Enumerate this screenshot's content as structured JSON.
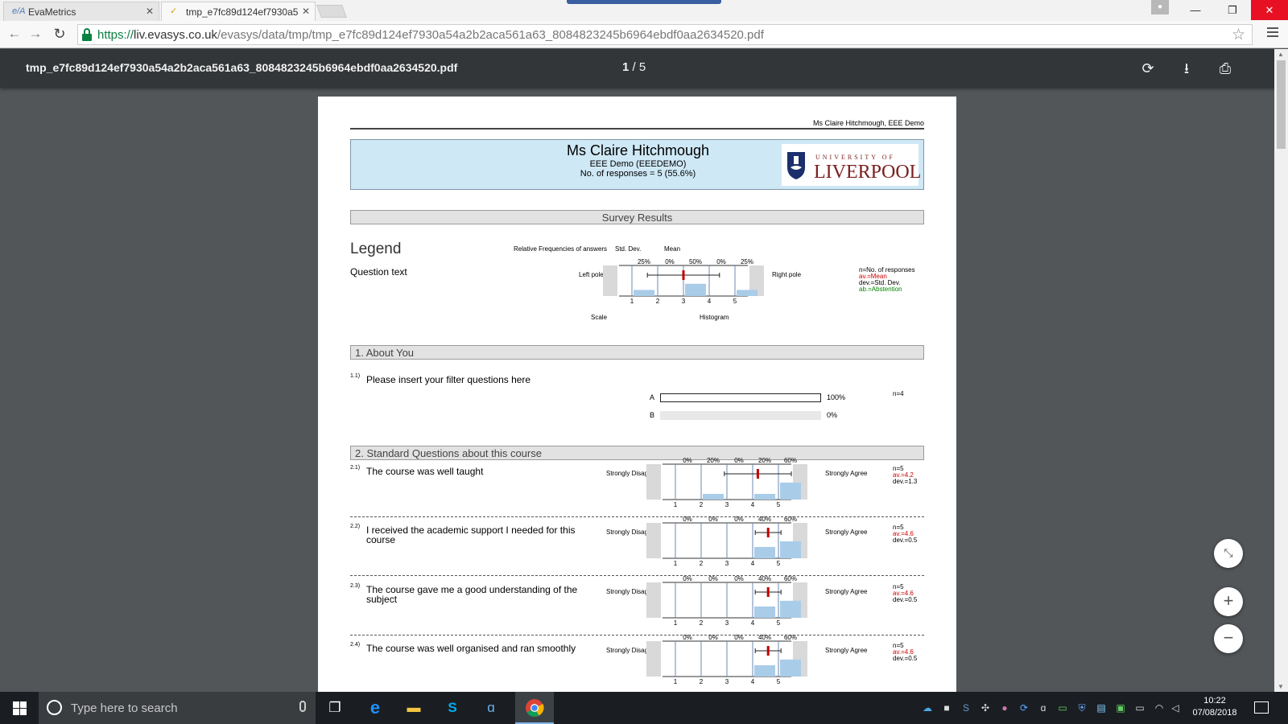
{
  "browser": {
    "tabs": [
      {
        "label": "EvaMetrics",
        "icon": "evametrics-icon"
      },
      {
        "label": "tmp_e7fc89d124ef7930a5",
        "icon": "checkmark-icon"
      }
    ],
    "url": {
      "scheme": "https://",
      "host": "liv.evasys.co.uk",
      "path": "/evasys/data/tmp/tmp_e7fc89d124ef7930a54a2b2aca561a63_8084823245b6964ebdf0aa2634520.pdf"
    }
  },
  "pdf_viewer": {
    "filename": "tmp_e7fc89d124ef7930a54a2b2aca561a63_8084823245b6964ebdf0aa2634520.pdf",
    "page_current": "1",
    "page_total": "/ 5"
  },
  "report": {
    "header_right": "Ms Claire Hitchmough, EEE Demo",
    "title": "Ms Claire Hitchmough",
    "subtitle": "EEE Demo (EEEDEMO)",
    "responses": "No. of responses = 5 (55.6%)",
    "logo": {
      "line1": "UNIVERSITY OF",
      "line2": "LIVERPOOL"
    },
    "survey_results": "Survey Results",
    "legend": {
      "title": "Legend",
      "question_text": "Question text",
      "rel_freq": "Relative Frequencies of answers",
      "std_dev": "Std. Dev.",
      "mean": "Mean",
      "left_pole": "Left pole",
      "right_pole": "Right pole",
      "scale": "Scale",
      "histogram": "Histogram",
      "pcts": [
        "25%",
        "0%",
        "50%",
        "0%",
        "25%"
      ],
      "key_n": "n=No. of responses",
      "key_av": "av.=Mean",
      "key_dev": "dev.=Std. Dev.",
      "key_ab": "ab.=Abstention"
    },
    "section1": {
      "title": "1. About You",
      "q_num": "1.1)",
      "q_text": "Please insert your filter questions here",
      "options": [
        {
          "label": "A",
          "pct": "100%",
          "value": 1.0
        },
        {
          "label": "B",
          "pct": "0%",
          "value": 0.0
        }
      ],
      "n": "n=4"
    },
    "section2": {
      "title": "2. Standard Questions about this course",
      "left_pole": "Strongly Disagree",
      "right_pole": "Strongly Agree",
      "scale": [
        "1",
        "2",
        "3",
        "4",
        "5"
      ],
      "questions": [
        {
          "num": "2.1)",
          "text": "The course was well taught",
          "pcts": [
            "0%",
            "20%",
            "0%",
            "20%",
            "60%"
          ],
          "freq": [
            0,
            20,
            0,
            20,
            60
          ],
          "mean": 4.2,
          "dev": 1.3,
          "n": "n=5",
          "av": "av.=4.2",
          "dv": "dev.=1.3"
        },
        {
          "num": "2.2)",
          "text": "I received the academic support I needed for this course",
          "pcts": [
            "0%",
            "0%",
            "0%",
            "40%",
            "60%"
          ],
          "freq": [
            0,
            0,
            0,
            40,
            60
          ],
          "mean": 4.6,
          "dev": 0.5,
          "n": "n=5",
          "av": "av.=4.6",
          "dv": "dev.=0.5"
        },
        {
          "num": "2.3)",
          "text": "The course gave me a good understanding of the subject",
          "pcts": [
            "0%",
            "0%",
            "0%",
            "40%",
            "60%"
          ],
          "freq": [
            0,
            0,
            0,
            40,
            60
          ],
          "mean": 4.6,
          "dev": 0.5,
          "n": "n=5",
          "av": "av.=4.6",
          "dv": "dev.=0.5"
        },
        {
          "num": "2.4)",
          "text": "The course was well organised and ran smoothly",
          "pcts": [
            "0%",
            "0%",
            "0%",
            "40%",
            "60%"
          ],
          "freq": [
            0,
            0,
            0,
            40,
            60
          ],
          "mean": 4.6,
          "dev": 0.5,
          "n": "n=5",
          "av": "av.=4.6",
          "dv": "dev.=0.5"
        }
      ]
    }
  },
  "taskbar": {
    "search_placeholder": "Type here to search",
    "time": "10:22",
    "date": "07/08/2018"
  },
  "colors": {
    "bar": "#a9cce8",
    "mean": "#c00000",
    "banner": "#cfe8f6"
  }
}
